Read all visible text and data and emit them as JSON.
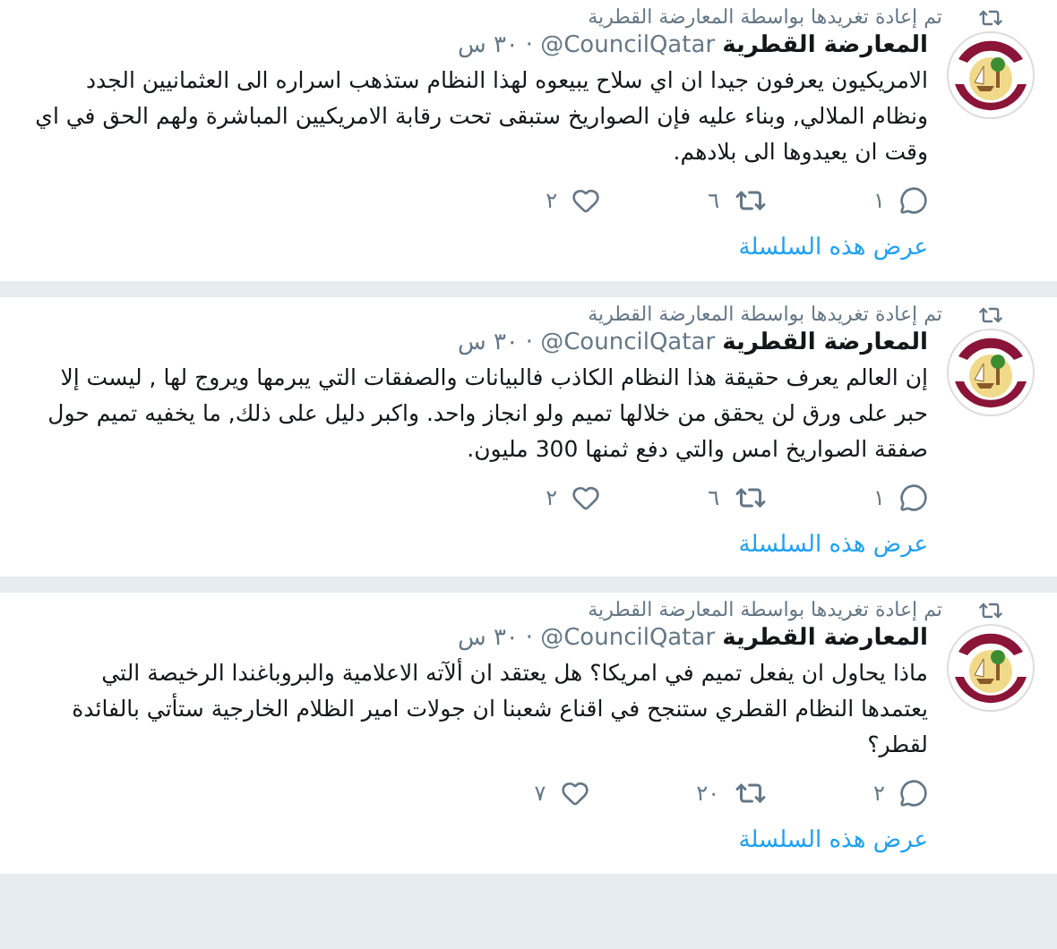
{
  "tweets": [
    {
      "retweeted_by": "تم إعادة تغريدها بواسطة المعارضة القطرية",
      "name": "المعارضة القطرية",
      "handle": "@CouncilQatar",
      "separator": "·",
      "time": "٣٠ س",
      "text": "الامريكيون يعرفون جيدا ان اي سلاح يبيعوه لهذا النظام ستذهب اسراره الى  العثمانيين الجدد ونظام الملالي, وبناء عليه فإن الصواريخ ستبقى تحت رقابة الامريكيين المباشرة ولهم الحق في اي وقت ان يعيدوها الى بلادهم.",
      "replies": "١",
      "retweets": "٦",
      "likes": "٢",
      "thread_link": "عرض هذه السلسلة"
    },
    {
      "retweeted_by": "تم إعادة تغريدها بواسطة المعارضة القطرية",
      "name": "المعارضة القطرية",
      "handle": "@CouncilQatar",
      "separator": "·",
      "time": "٣٠ س",
      "text": "إن العالم يعرف حقيقة هذا النظام الكاذب  فالبيانات والصفقات التي يبرمها ويروج لها , ليست إلا حبر على ورق لن يحقق من خلالها تميم ولو انجاز واحد. واكبر دليل على ذلك, ما يخفيه تميم حول صفقة الصواريخ امس والتي دفع ثمنها 300 مليون.",
      "replies": "١",
      "retweets": "٦",
      "likes": "٢",
      "thread_link": "عرض هذه السلسلة"
    },
    {
      "retweeted_by": "تم إعادة تغريدها بواسطة المعارضة القطرية",
      "name": "المعارضة القطرية",
      "handle": "@CouncilQatar",
      "separator": "·",
      "time": "٣٠ س",
      "text": "ماذا يحاول ان يفعل تميم في امريكا؟ هل يعتقد ان  ألآته الاعلامية والبروباغندا الرخيصة التي يعتمدها النظام القطري ستنجح في اقناع شعبنا ان جولات امير الظلام الخارجية ستأتي بالفائدة لقطر؟",
      "replies": "٢",
      "retweets": "٢٠",
      "likes": "٧",
      "thread_link": "عرض هذه السلسلة"
    }
  ]
}
